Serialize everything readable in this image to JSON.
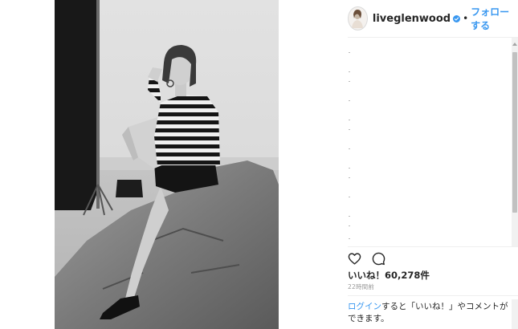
{
  "post": {
    "username": "liveglenwood",
    "follow_label": "フォローする",
    "separator": "•",
    "likes_label": "いいね！60,278件",
    "timestamp": "22時間前"
  },
  "login_prompt": {
    "link_text": "ログイン",
    "rest_text": "すると「いいね！」やコメントができます。"
  },
  "colors": {
    "link": "#3897f0",
    "text": "#262626",
    "muted": "#999999"
  },
  "icons": [
    "verified-badge-icon",
    "heart-icon",
    "comment-icon"
  ]
}
